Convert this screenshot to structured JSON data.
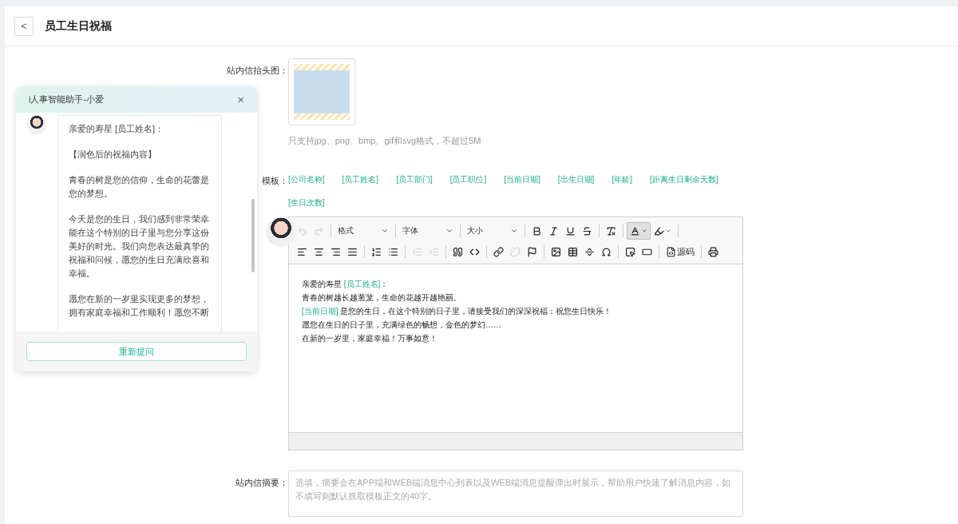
{
  "page": {
    "title": "员工生日祝福",
    "back": "<"
  },
  "form": {
    "header_image": {
      "label": "站内信抬头图：",
      "hint": "只支持jpg、png、bmp、gif和svg格式，不超过5M"
    },
    "template": {
      "label": "模板：",
      "tags": [
        "[公司名称]",
        "[员工姓名]",
        "[员工部门]",
        "[员工职位]",
        "[当前日期]",
        "[出生日期]",
        "[年龄]",
        "[距离生日剩余天数]",
        "[生日次数]"
      ]
    },
    "editor": {
      "toolbar": {
        "rows": [
          [
            {
              "kind": "button",
              "disabled": true,
              "pressed": false
            },
            {
              "kind": "button",
              "disabled": true,
              "pressed": false
            },
            {
              "kind": "separator"
            },
            {
              "kind": "dropdown",
              "label": "格式"
            },
            {
              "kind": "separator"
            },
            {
              "kind": "dropdown",
              "label": "字体"
            },
            {
              "kind": "separator"
            },
            {
              "kind": "dropdown",
              "label": "大小"
            },
            {
              "kind": "separator"
            },
            {
              "kind": "button",
              "disabled": false,
              "pressed": false
            },
            {
              "kind": "button",
              "disabled": false,
              "pressed": false
            },
            {
              "kind": "button",
              "disabled": false,
              "pressed": false
            },
            {
              "kind": "button",
              "disabled": false,
              "pressed": false
            },
            {
              "kind": "separator"
            },
            {
              "kind": "button",
              "disabled": false,
              "pressed": false
            },
            {
              "kind": "separator"
            },
            {
              "kind": "button",
              "disabled": false,
              "pressed": true
            },
            {
              "kind": "button",
              "disabled": false,
              "pressed": false
            },
            {
              "kind": "separator"
            }
          ],
          [
            {
              "kind": "button",
              "disabled": false,
              "pressed": false
            },
            {
              "kind": "button",
              "disabled": false,
              "pressed": false
            },
            {
              "kind": "button",
              "disabled": false,
              "pressed": false
            },
            {
              "kind": "button",
              "disabled": false,
              "pressed": false
            },
            {
              "kind": "separator"
            },
            {
              "kind": "button",
              "disabled": false,
              "pressed": false
            },
            {
              "kind": "button",
              "disabled": false,
              "pressed": false
            },
            {
              "kind": "separator"
            },
            {
              "kind": "button",
              "disabled": true,
              "pressed": false
            },
            {
              "kind": "button",
              "disabled": true,
              "pressed": false
            },
            {
              "kind": "separator"
            },
            {
              "kind": "button",
              "disabled": false,
              "pressed": false
            },
            {
              "kind": "button",
              "disabled": false,
              "pressed": false
            },
            {
              "kind": "separator"
            },
            {
              "kind": "button",
              "disabled": false,
              "pressed": false
            },
            {
              "kind": "button",
              "disabled": true,
              "pressed": false
            },
            {
              "kind": "button",
              "disabled": false,
              "pressed": false
            },
            {
              "kind": "separator"
            },
            {
              "kind": "button",
              "disabled": false,
              "pressed": false
            },
            {
              "kind": "button",
              "disabled": false,
              "pressed": false
            },
            {
              "kind": "button",
              "disabled": false,
              "pressed": false
            },
            {
              "kind": "button",
              "disabled": false,
              "pressed": false
            },
            {
              "kind": "separator"
            },
            {
              "kind": "button",
              "disabled": false,
              "pressed": false
            },
            {
              "kind": "button",
              "disabled": false,
              "pressed": false
            },
            {
              "kind": "separator"
            },
            {
              "kind": "text-button",
              "label": "源码"
            },
            {
              "kind": "separator"
            },
            {
              "kind": "button",
              "disabled": false,
              "pressed": false
            }
          ]
        ]
      },
      "content": [
        [
          {
            "kind": "text",
            "text": "亲爱的寿星 "
          },
          {
            "kind": "tag",
            "text": "[员工姓名]"
          },
          {
            "kind": "text",
            "text": "："
          }
        ],
        [
          {
            "kind": "text",
            "text": "青春的树越长越葱茏，生命的花越开越艳丽。"
          }
        ],
        [
          {
            "kind": "tag",
            "text": "[当前日期]"
          },
          {
            "kind": "text",
            "text": " 是您的生日，在这个特别的日子里，请接受我们的深深祝福：祝您生日快乐！"
          }
        ],
        [
          {
            "kind": "text",
            "text": "愿您在生日的日子里，充满绿色的畅想，金色的梦幻……"
          }
        ],
        [
          {
            "kind": "text",
            "text": "在新的一岁里，家庭幸福！万事如意！"
          }
        ]
      ]
    },
    "summary": {
      "label": "站内信摘要：",
      "placeholder": "选填，摘要会在APP端和WEB端消息中心列表以及WEB端消息提醒弹出时展示，帮助用户快速了解消息内容，如不填写则默认抓取模板正文的40字。"
    }
  },
  "assistant": {
    "title": "i人事智能助手-小爱",
    "close": "×",
    "message": [
      "亲爱的寿星 [员工姓名]：",
      "【润色后的祝福内容】",
      "青春的树是您的信仰，生命的花蕾是您的梦想。",
      "今天是您的生日，我们感到非常荣幸能在这个特别的日子里与您分享这份美好的时光。我们向您表达最真挚的祝福和问候，愿您的生日充满欣喜和幸福。",
      "愿您在新的一岁里实现更多的梦想，拥有家庭幸福和工作顺利！愿您不断"
    ],
    "button": "重新提问"
  }
}
